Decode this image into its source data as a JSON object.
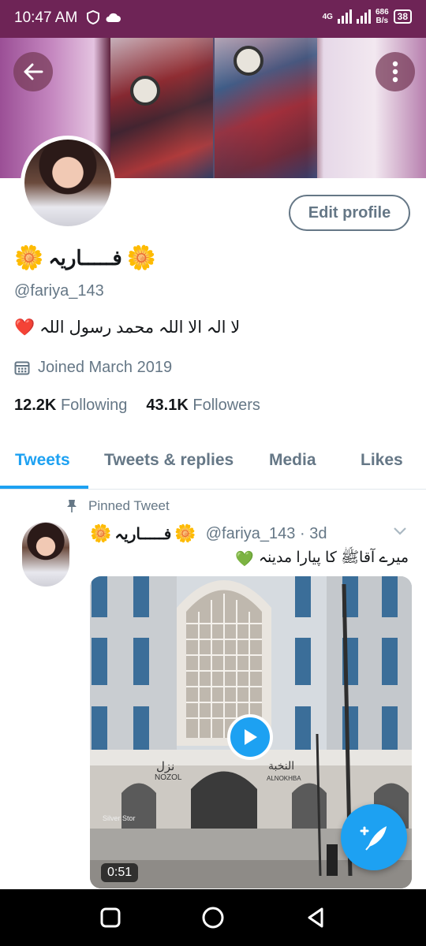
{
  "status_bar": {
    "time": "10:47 AM",
    "network_speed_value": "686",
    "network_speed_unit": "B/s",
    "network_type": "4G",
    "battery": "38"
  },
  "profile": {
    "name": "فـــــاریہ",
    "name_decoration": "🌼",
    "handle": "@fariya_143",
    "bio_text": "لا الہ الا اللہ محمد رسول اللہ",
    "bio_emoji": "❤️",
    "joined": "Joined March 2019",
    "following_count": "12.2K",
    "following_label": "Following",
    "followers_count": "43.1K",
    "followers_label": "Followers",
    "edit_button": "Edit profile"
  },
  "tabs": [
    {
      "label": "Tweets",
      "active": true
    },
    {
      "label": "Tweets & replies",
      "active": false
    },
    {
      "label": "Media",
      "active": false
    },
    {
      "label": "Likes",
      "active": false
    }
  ],
  "pinned_tweet": {
    "pinned_label": "Pinned Tweet",
    "author_name": "فـــــاریہ",
    "handle_time": "@fariya_143 · 3d",
    "text": "میرے آقاﷺ کا پیارا مدینہ",
    "emoji": "💚",
    "video_duration": "0:51",
    "sign_left": "نزل",
    "sign_left_en": "NOZOL",
    "sign_right": "النخبة",
    "sign_right_en": "ALNOKHBA",
    "shop_sign": "Silver Stor"
  },
  "colors": {
    "accent": "#1da1f2",
    "status_bar": "#6e2456",
    "secondary_text": "#657786"
  }
}
